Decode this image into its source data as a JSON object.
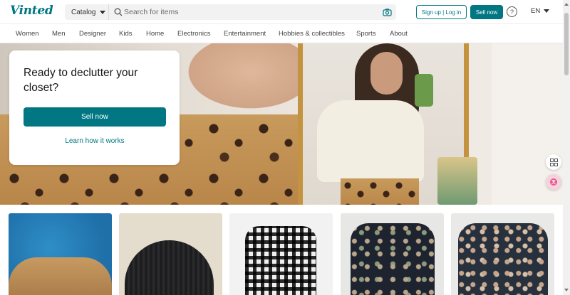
{
  "header": {
    "logo": "Vinted",
    "catalog_label": "Catalog",
    "search_placeholder": "Search for items",
    "signup_label": "Sign up | Log in",
    "sell_label": "Sell now",
    "help_glyph": "?",
    "language": "EN"
  },
  "nav": {
    "items": [
      "Women",
      "Men",
      "Designer",
      "Kids",
      "Home",
      "Electronics",
      "Entertainment",
      "Hobbies & collectibles",
      "Sports",
      "About"
    ]
  },
  "hero": {
    "title": "Ready to declutter your closet?",
    "sell_label": "Sell now",
    "learn_label": "Learn how it works"
  },
  "products": [
    {
      "item": "blue-graphic-hoodie"
    },
    {
      "item": "black-knit-beanie"
    },
    {
      "item": "plaid-duffle-coat"
    },
    {
      "item": "floral-sheer-blouse"
    },
    {
      "item": "floral-print-blouse"
    }
  ],
  "colors": {
    "accent": "#007782",
    "text": "#171717",
    "search_bg": "#f2f2f2"
  },
  "icons": [
    "search-icon",
    "camera-icon",
    "help-icon",
    "chevron-down-icon",
    "grid-icon",
    "translate-icon"
  ]
}
